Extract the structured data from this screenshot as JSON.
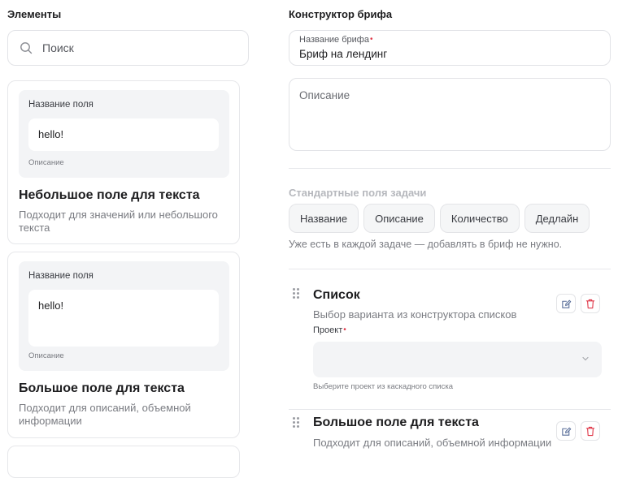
{
  "elements_panel": {
    "title": "Элементы",
    "search": {
      "placeholder": "Поиск",
      "value": ""
    },
    "cards": [
      {
        "preview_label": "Название поля",
        "preview_value": "hello!",
        "preview_desc": "Описание",
        "title": "Небольшое поле для текста",
        "description": "Подходит для значений или небольшого текста"
      },
      {
        "preview_label": "Название поля",
        "preview_value": "hello!",
        "preview_desc": "Описание",
        "title": "Большое поле для текста",
        "description": "Подходит для описаний, объемной информации"
      }
    ]
  },
  "builder": {
    "title": "Конструктор брифа",
    "brief_name": {
      "label": "Название брифа",
      "value": "Бриф на лендинг"
    },
    "description": {
      "placeholder": "Описание"
    },
    "standard_fields": {
      "title": "Стандартные поля задачи",
      "chips": [
        "Название",
        "Описание",
        "Количество",
        "Дедлайн"
      ],
      "note": "Уже есть в каждой задаче — добавлять в бриф не нужно."
    },
    "blocks": [
      {
        "title": "Список",
        "description": "Выбор варианта из конструктора списков",
        "field_label": "Проект",
        "select_value": "",
        "hint": "Выберите проект из каскадного списка"
      },
      {
        "title": "Большое поле для текста",
        "description": "Подходит для описаний, объемной информации"
      }
    ]
  },
  "icons": {
    "search": "search-icon",
    "edit": "edit-icon",
    "delete": "trash-icon",
    "drag": "drag-handle-icon",
    "chevron": "chevron-down-icon"
  },
  "colors": {
    "required": "#e0394a",
    "delete": "#e0394a",
    "edit": "#5a6f9a"
  }
}
